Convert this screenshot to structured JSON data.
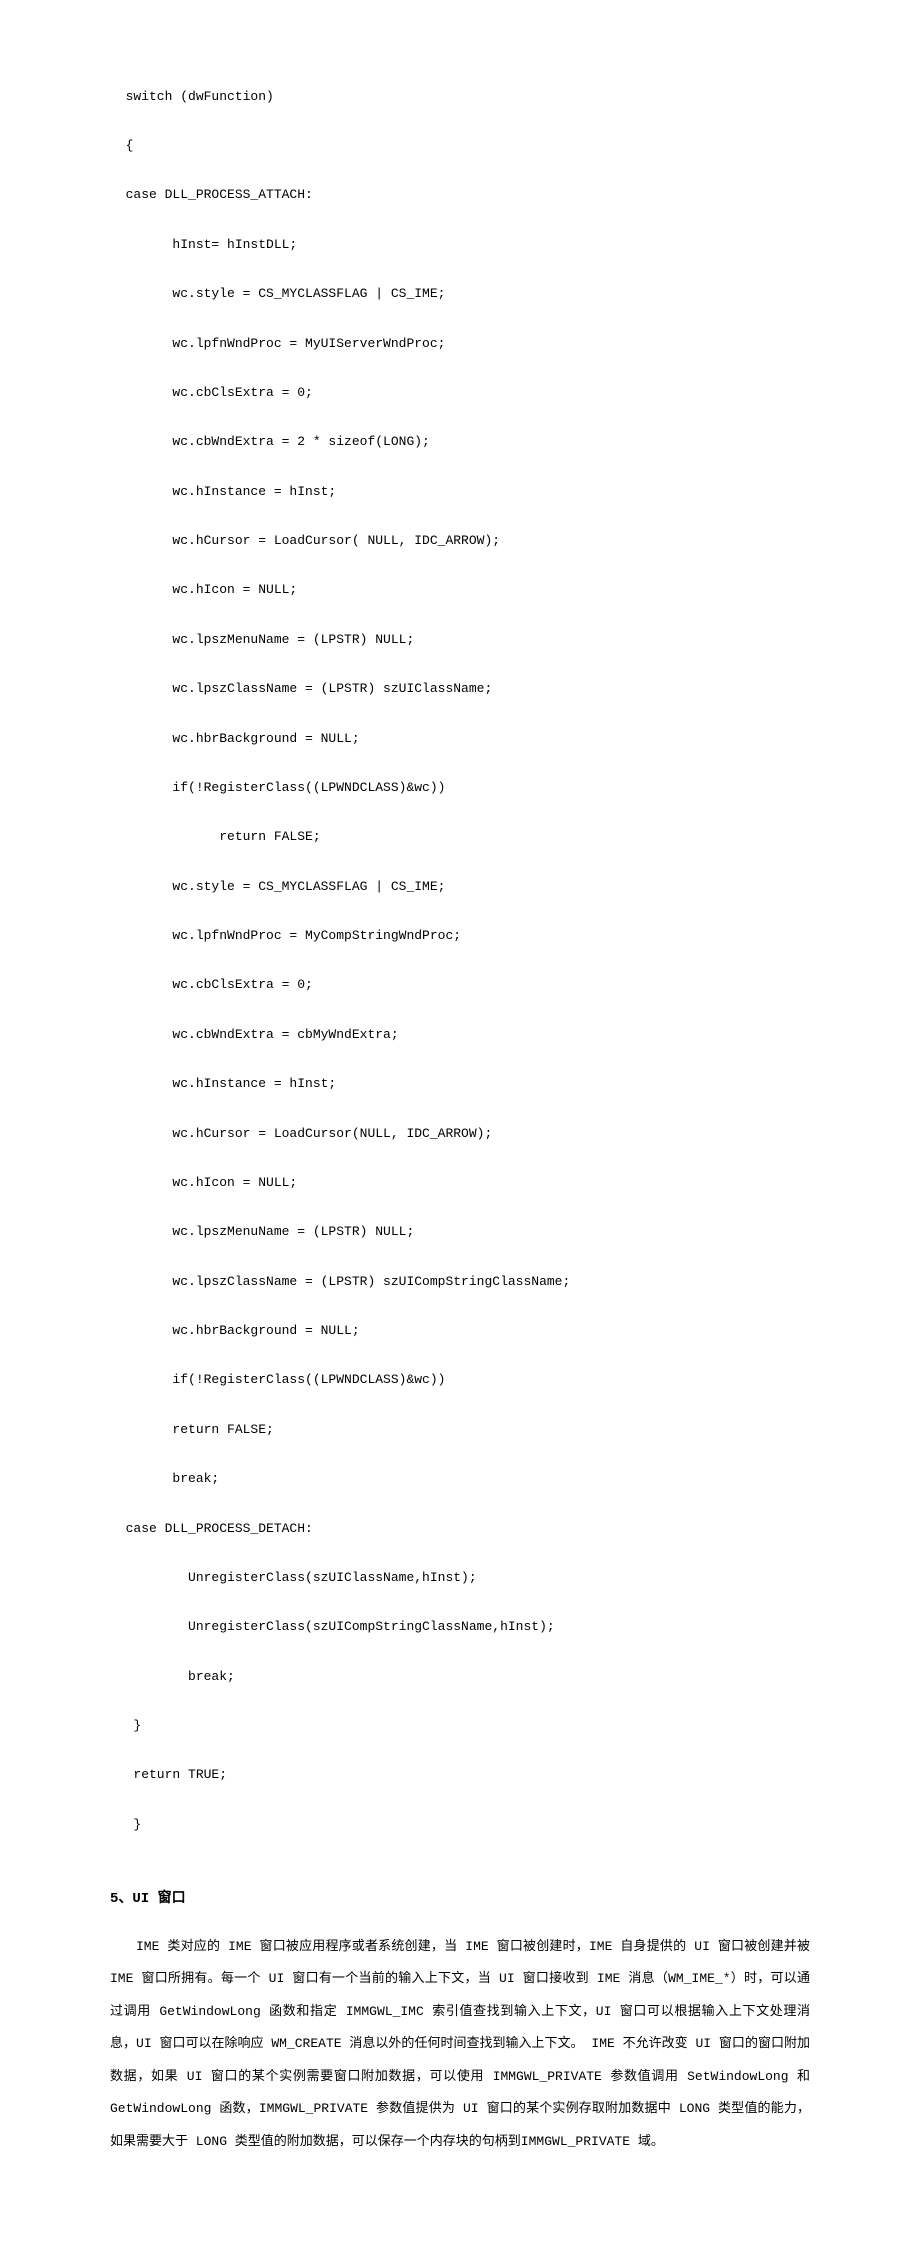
{
  "code": {
    "l1": "  switch (dwFunction)",
    "l2": "  {",
    "l3": "  case DLL_PROCESS_ATTACH:",
    "l4": "        hInst= hInstDLL;",
    "l5": "        wc.style = CS_MYCLASSFLAG | CS_IME;",
    "l6": "        wc.lpfnWndProc = MyUIServerWndProc;",
    "l7": "        wc.cbClsExtra = 0;",
    "l8": "        wc.cbWndExtra = 2 * sizeof(LONG);",
    "l9": "        wc.hInstance = hInst;",
    "l10": "        wc.hCursor = LoadCursor( NULL, IDC_ARROW);",
    "l11": "        wc.hIcon = NULL;",
    "l12": "        wc.lpszMenuName = (LPSTR) NULL;",
    "l13": "        wc.lpszClassName = (LPSTR) szUIClassName;",
    "l14": "        wc.hbrBackground = NULL;",
    "l15": "        if(!RegisterClass((LPWNDCLASS)&wc))",
    "l16": "              return FALSE;",
    "l17": "        wc.style = CS_MYCLASSFLAG | CS_IME;",
    "l18": "        wc.lpfnWndProc = MyCompStringWndProc;",
    "l19": "        wc.cbClsExtra = 0;",
    "l20": "        wc.cbWndExtra = cbMyWndExtra;",
    "l21": "        wc.hInstance = hInst;",
    "l22": "        wc.hCursor = LoadCursor(NULL, IDC_ARROW);",
    "l23": "        wc.hIcon = NULL;",
    "l24": "        wc.lpszMenuName = (LPSTR) NULL;",
    "l25": "        wc.lpszClassName = (LPSTR) szUICompStringClassName;",
    "l26": "        wc.hbrBackground = NULL;",
    "l27": "        if(!RegisterClass((LPWNDCLASS)&wc))",
    "l28": "        return FALSE;",
    "l29": "        break;",
    "l30": "  case DLL_PROCESS_DETACH:",
    "l31": "          UnregisterClass(szUIClassName,hInst);",
    "l32": "          UnregisterClass(szUICompStringClassName,hInst);",
    "l33": "          break;",
    "l34": "   }",
    "l35": "   return TRUE;",
    "l36": "   }"
  },
  "heading": "5、UI 窗口",
  "paragraph": "IME 类对应的 IME 窗口被应用程序或者系统创建，当 IME 窗口被创建时，IME 自身提供的 UI 窗口被创建并被 IME 窗口所拥有。每一个 UI 窗口有一个当前的输入上下文，当 UI 窗口接收到 IME 消息（WM_IME_*）时，可以通过调用 GetWindowLong 函数和指定 IMMGWL_IMC 索引值查找到输入上下文，UI 窗口可以根据输入上下文处理消息，UI 窗口可以在除响应 WM_CREATE 消息以外的任何时间查找到输入上下文。 IME 不允许改变 UI 窗口的窗口附加数据，如果 UI 窗口的某个实例需要窗口附加数据，可以使用 IMMGWL_PRIVATE 参数值调用 SetWindowLong 和 GetWindowLong 函数，IMMGWL_PRIVATE 参数值提供为 UI 窗口的某个实例存取附加数据中 LONG 类型值的能力，如果需要大于 LONG 类型值的附加数据，可以保存一个内存块的句柄到IMMGWL_PRIVATE 域。"
}
